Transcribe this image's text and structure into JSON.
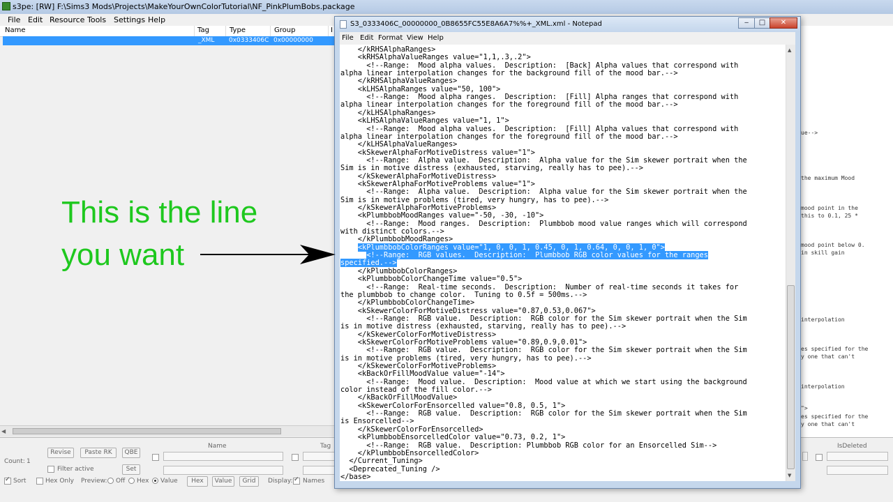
{
  "s3pe": {
    "title": "s3pe: [RW] F:\\Sims3 Mods\\Projects\\MakeYourOwnColorTutorial\\NF_PinkPlumBobs.package",
    "menu": [
      "File",
      "Edit",
      "Resource",
      "Tools",
      "Settings",
      "Help"
    ],
    "columns": [
      "Name",
      "Tag",
      "Type",
      "Group",
      "I"
    ],
    "row": {
      "tag": "_XML",
      "type": "0x0333406C",
      "group": "0x00000000"
    },
    "right_panel_fragments": [
      "ue-->",
      "the maximum Mood",
      "mood point in the",
      "this to 0.1, 25 *",
      "mood point below 0.",
      "in skill gain",
      "interpolation",
      "es specified for the",
      "y one that can't",
      "interpolation",
      "\">",
      "es specified for the",
      "y one that can't"
    ],
    "bottom": {
      "count_label": "Count:",
      "count_value": "1",
      "revise": "Revise",
      "paste_rk": "Paste RK",
      "qbe": "QBE",
      "set": "Set",
      "filter_active": "Filter active",
      "name_label": "Name",
      "tag_label": "Tag",
      "isdeleted_label": "IsDeleted",
      "sort": "Sort",
      "hex_only": "Hex Only",
      "preview": "Preview:",
      "off": "Off",
      "hex": "Hex",
      "value": "Value",
      "hex_btn": "Hex",
      "value_btn": "Value",
      "grid_btn": "Grid",
      "display": "Display:",
      "names": "Names"
    }
  },
  "notepad": {
    "title": "S3_0333406C_00000000_0B8655FC55E8A6A7%%+_XML.xml - Notepad",
    "menu": [
      "File",
      "Edit",
      "Format",
      "View",
      "Help"
    ],
    "lines": [
      "    </kRHSAlphaRanges>",
      "    <kRHSAlphaValueRanges value=\"1,1,.3,.2\">",
      "      <!--Range:  Mood alpha values.  Description:  [Back] Alpha values that correspond with",
      "alpha linear interpolation changes for the background fill of the mood bar.-->",
      "    </kRHSAlphaValueRanges>",
      "    <kLHSAlphaRanges value=\"50, 100\">",
      "      <!--Range:  Mood alpha ranges.  Description:  [Fill] Alpha ranges that correspond with",
      "alpha linear interpolation changes for the foreground fill of the mood bar.-->",
      "    </kLHSAlphaRanges>",
      "    <kLHSAlphaValueRanges value=\"1, 1\">",
      "      <!--Range:  Mood alpha values.  Description:  [Fill] Alpha values that correspond with",
      "alpha linear interpolation changes for the foreground fill of the mood bar.-->",
      "    </kLHSAlphaValueRanges>",
      "    <kSkewerAlphaForMotiveDistress value=\"1\">",
      "      <!--Range:  Alpha value.  Description:  Alpha value for the Sim skewer portrait when the",
      "Sim is in motive distress (exhausted, starving, really has to pee).-->",
      "    </kSkewerAlphaForMotiveDistress>",
      "    <kSkewerAlphaForMotiveProblems value=\"1\">",
      "      <!--Range:  Alpha value.  Description:  Alpha value for the Sim skewer portrait when the",
      "Sim is in motive problems (tired, very hungry, has to pee).-->",
      "    </kSkewerAlphaForMotiveProblems>",
      "    <kPlumbbobMoodRanges value=\"-50, -30, -10\">",
      "      <!--Range:  Mood ranges.  Description:  Plumbbob mood value ranges which will correspond",
      "with distinct colors.-->",
      "    </kPlumbbobMoodRanges>",
      "    <kPlumbbobColorRanges value=\"1, 0, 0, 1, 0.45, 0, 1, 0.64, 0, 0, 1, 0\">",
      "      <!--Range:  RGB values.  Description:  Plumbbob RGB color values for the ranges",
      "specified.-->",
      "    </kPlumbbobColorRanges>",
      "    <kPlumbbobColorChangeTime value=\"0.5\">",
      "      <!--Range:  Real-time seconds.  Description:  Number of real-time seconds it takes for",
      "the plumbbob to change color.  Tuning to 0.5f = 500ms.-->",
      "    </kPlumbbobColorChangeTime>",
      "    <kSkewerColorForMotiveDistress value=\"0.87,0.53,0.067\">",
      "      <!--Range:  RGB value.  Description:  RGB color for the Sim skewer portrait when the Sim",
      "is in motive distress (exhausted, starving, really has to pee).-->",
      "    </kSkewerColorForMotiveDistress>",
      "    <kSkewerColorForMotiveProblems value=\"0.89,0.9,0.01\">",
      "      <!--Range:  RGB value.  Description:  RGB color for the Sim skewer portrait when the Sim",
      "is in motive problems (tired, very hungry, has to pee).-->",
      "    </kSkewerColorForMotiveProblems>",
      "    <kBackOrFillMoodValue value=\"-14\">",
      "      <!--Range:  Mood value.  Description:  Mood value at which we start using the background",
      "color instead of the fill color.-->",
      "    </kBackOrFillMoodValue>",
      "    <kSkewerColorForEnsorcelled value=\"0.8, 0.5, 1\">",
      "      <!--Range:  RGB value.  Description:  RGB color for the Sim skewer portrait when the Sim",
      "is Ensorcelled-->",
      "    </kSkewerColorForEnsorcelled>",
      "    <kPlumbbobEnsorcelledColor value=\"0.73, 0.2, 1\">",
      "      <!--Range:  RGB value.  Description: Plumbbob RGB color for an Ensorcelled Sim-->",
      "    </kPlumbbobEnsorcelledColor>",
      "  </Current_Tuning>",
      "  <Deprecated_Tuning />",
      "</base>"
    ],
    "selected_lines": [
      25,
      26,
      27
    ]
  },
  "annotation": {
    "line1": "This is the line",
    "line2": "you want",
    "color": "#1ec81e"
  },
  "colors": {
    "selection": "#3399ff",
    "titlebar": "#c4d6ec"
  }
}
